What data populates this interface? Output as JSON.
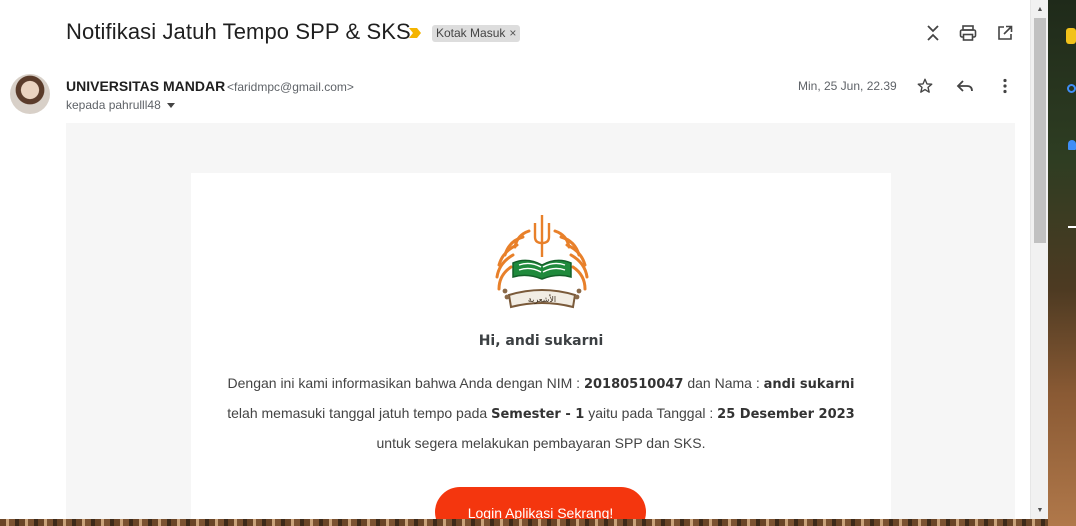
{
  "email": {
    "subject": "Notifikasi Jatuh Tempo SPP & SKS",
    "label": "Kotak Masuk",
    "label_remove": "×",
    "sender_name": "UNIVERSITAS MANDAR",
    "sender_email": "<faridmpc@gmail.com>",
    "recipient": "kepada pahrulll48",
    "date": "Min, 25 Jun, 22.39"
  },
  "body": {
    "greeting": "Hi, andi sukarni",
    "line1_pre": "Dengan ini kami informasikan bahwa Anda dengan NIM : ",
    "nim": "20180510047",
    "line1_mid": " dan Nama : ",
    "name": "andi sukarni",
    "line2_pre": "telah memasuki tanggal jatuh tempo pada ",
    "semester": "Semester - 1",
    "line2_mid": " yaitu pada Tanggal : ",
    "due_date": "25 Desember 2023",
    "line3": "untuk segera melakukan pembayaran SPP dan SKS.",
    "cta_label": "Login Aplikasi Sekrang!",
    "logo_text": "الأشعرية"
  },
  "icons": {
    "importance": "importance-marker-icon",
    "collapse": "collapse-all-icon",
    "print": "print-icon",
    "open_new": "open-in-new-window-icon",
    "star": "star-icon",
    "reply": "reply-icon",
    "more": "more-vert-icon"
  },
  "colors": {
    "cta": "#f4360e",
    "importance": "#f4b400",
    "logo_orange": "#e8802a",
    "logo_green": "#1f8a3c"
  }
}
